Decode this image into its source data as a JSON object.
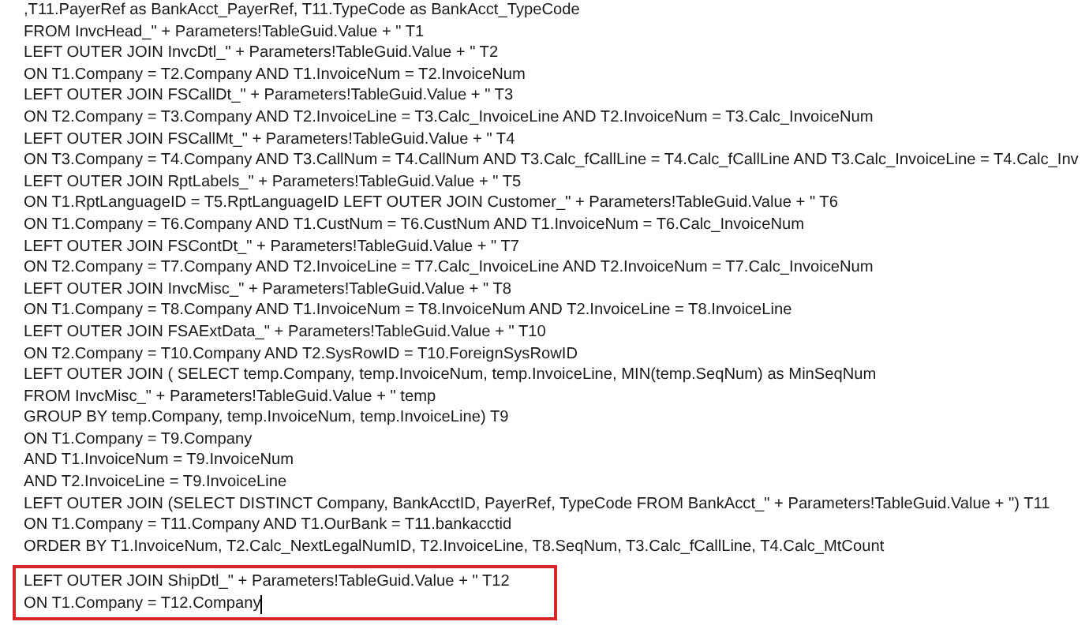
{
  "editor": {
    "lines": [
      ",T11.PayerRef as BankAcct_PayerRef, T11.TypeCode as BankAcct_TypeCode",
      "FROM InvcHead_\" + Parameters!TableGuid.Value + \" T1",
      "LEFT OUTER JOIN InvcDtl_\" + Parameters!TableGuid.Value + \" T2",
      "ON T1.Company = T2.Company AND T1.InvoiceNum = T2.InvoiceNum",
      "LEFT OUTER JOIN FSCallDt_\" + Parameters!TableGuid.Value + \" T3",
      "ON T2.Company = T3.Company AND T2.InvoiceLine = T3.Calc_InvoiceLine AND T2.InvoiceNum = T3.Calc_InvoiceNum",
      "LEFT OUTER JOIN FSCallMt_\" + Parameters!TableGuid.Value + \" T4",
      "ON T3.Company = T4.Company AND T3.CallNum = T4.CallNum AND T3.Calc_fCallLine = T4.Calc_fCallLine AND T3.Calc_InvoiceLine = T4.Calc_Inv",
      "LEFT OUTER JOIN RptLabels_\" + Parameters!TableGuid.Value + \" T5",
      "ON T1.RptLanguageID = T5.RptLanguageID LEFT OUTER JOIN Customer_\" + Parameters!TableGuid.Value + \" T6",
      "ON T1.Company = T6.Company AND T1.CustNum = T6.CustNum AND T1.InvoiceNum = T6.Calc_InvoiceNum",
      "LEFT OUTER JOIN FSContDt_\" + Parameters!TableGuid.Value + \" T7",
      "ON T2.Company = T7.Company AND T2.InvoiceLine = T7.Calc_InvoiceLine AND T2.InvoiceNum = T7.Calc_InvoiceNum",
      "LEFT OUTER JOIN InvcMisc_\" + Parameters!TableGuid.Value + \" T8",
      "ON T1.Company = T8.Company AND T1.InvoiceNum = T8.InvoiceNum AND T2.InvoiceLine = T8.InvoiceLine",
      "LEFT OUTER JOIN FSAExtData_\" + Parameters!TableGuid.Value + \" T10",
      "ON T2.Company = T10.Company AND T2.SysRowID = T10.ForeignSysRowID",
      "LEFT OUTER JOIN ( SELECT  temp.Company, temp.InvoiceNum, temp.InvoiceLine, MIN(temp.SeqNum) as MinSeqNum",
      "FROM InvcMisc_\" + Parameters!TableGuid.Value + \"  temp",
      "GROUP BY      temp.Company, temp.InvoiceNum, temp.InvoiceLine) T9",
      "ON T1.Company = T9.Company",
      "AND T1.InvoiceNum = T9.InvoiceNum",
      "AND T2.InvoiceLine = T9.InvoiceLine",
      "LEFT OUTER JOIN (SELECT DISTINCT Company, BankAcctID, PayerRef, TypeCode FROM BankAcct_\" + Parameters!TableGuid.Value + \") T11",
      "ON T1.Company = T11.Company AND T1.OurBank = T11.bankacctid",
      "ORDER BY  T1.InvoiceNum, T2.Calc_NextLegalNumID, T2.InvoiceLine, T8.SeqNum, T3.Calc_fCallLine, T4.Calc_MtCount"
    ],
    "highlighted_lines": [
      "LEFT OUTER JOIN ShipDtl_\" + Parameters!TableGuid.Value + \" T12",
      "ON T1.Company = T12.Company"
    ]
  }
}
